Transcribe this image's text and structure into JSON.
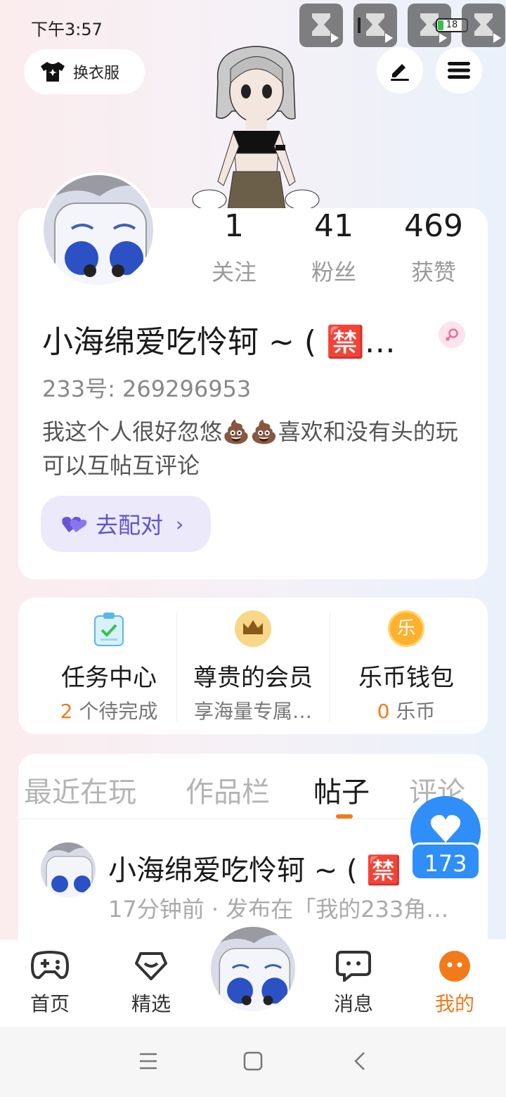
{
  "status_bar": {
    "time": "下午3:57",
    "battery": "18"
  },
  "top_bar": {
    "outfit_label": "换衣服"
  },
  "profile": {
    "stats": [
      {
        "value": "1",
        "label": "关注"
      },
      {
        "value": "41",
        "label": "粉丝"
      },
      {
        "value": "469",
        "label": "获赞"
      }
    ],
    "username": "小海绵爱吃怜轲 ~ ( 🈲…",
    "id_line": "233号: 269296953",
    "bio": "我这个人很好忽悠💩💩喜欢和没有头的玩可以互帖互评论",
    "match_label": "去配对"
  },
  "features": [
    {
      "title": "任务中心",
      "count": "2",
      "sub": " 个待完成"
    },
    {
      "title": "尊贵的会员",
      "sub": "享海量专属…"
    },
    {
      "title": "乐币钱包",
      "count": "0",
      "sub": " 乐币",
      "icon_char": "乐"
    }
  ],
  "tabs": [
    "最近在玩",
    "作品栏",
    "帖子",
    "评论"
  ],
  "post": {
    "title": "小海绵爱吃怜轲 ~ ( 🈲",
    "meta": "17分钟前 · 发布在「我的233角…"
  },
  "like_count": "173",
  "nav": [
    {
      "label": "首页"
    },
    {
      "label": "精选"
    },
    {
      "label": "消息"
    },
    {
      "label": "我的"
    }
  ],
  "colors": {
    "accent": "#f27a1a",
    "like_blue": "#2f8ef7",
    "match_purple": "#5f52cf"
  }
}
